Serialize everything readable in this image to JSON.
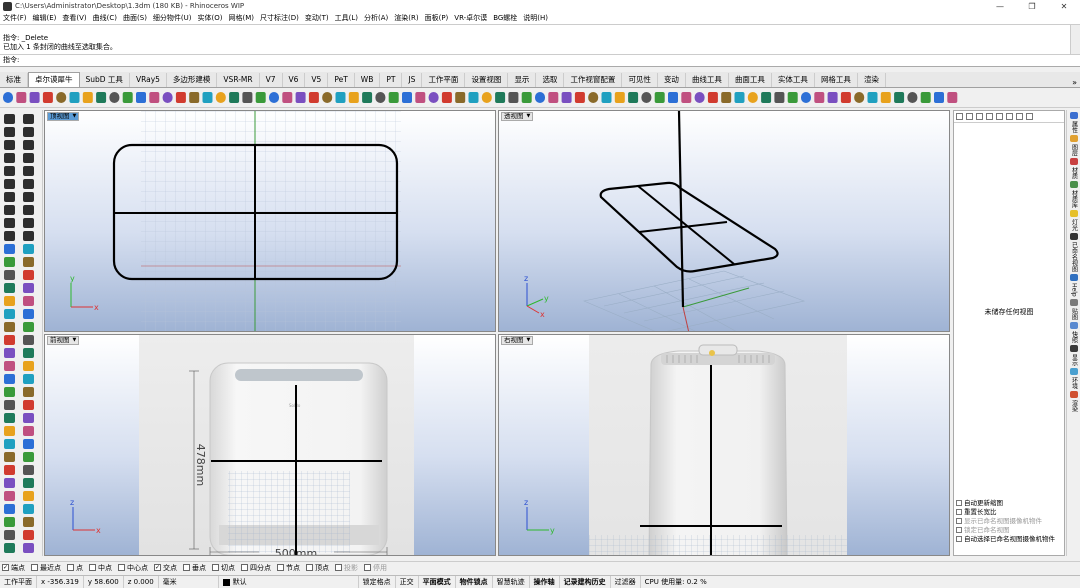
{
  "window": {
    "title": "C:\\Users\\Administrator\\Desktop\\1.3dm (180 KB) - Rhinoceros WIP"
  },
  "menu": [
    "文件(F)",
    "编辑(E)",
    "查看(V)",
    "曲线(C)",
    "曲面(S)",
    "细分物件(U)",
    "实体(O)",
    "网格(M)",
    "尺寸标注(D)",
    "变动(T)",
    "工具(L)",
    "分析(A)",
    "渲染(R)",
    "面板(P)",
    "VR-卓尔谟",
    "BG螺栓",
    "说明(H)"
  ],
  "command": {
    "line1": "指令: _Delete",
    "line2": "已加入 1 条封闭的曲线至选取集合。",
    "prompt": "指令:"
  },
  "tabs": [
    "标准",
    "卓尔谟犀牛",
    "SubD 工具",
    "VRay5",
    "多边形建模",
    "VSR-MR",
    "V7",
    "V6",
    "V5",
    "PeT",
    "WB",
    "PT",
    "JS",
    "工作平面",
    "设置视图",
    "显示",
    "选取",
    "工作视窗配置",
    "可见性",
    "变动",
    "曲线工具",
    "曲面工具",
    "实体工具",
    "网格工具",
    "渲染"
  ],
  "active_tab": "卓尔谟犀牛",
  "viewports": {
    "top": {
      "label": "顶视图"
    },
    "perspective": {
      "label": "透视图"
    },
    "front": {
      "label": "前视图",
      "dim_height": "478mm",
      "dim_width": "500mm",
      "brand": "SolBo"
    },
    "right": {
      "label": "右视图"
    }
  },
  "panel": {
    "empty_text": "未储存任何视图",
    "options": [
      "自动更新缩图",
      "重置长宽比",
      "显示已命名视图摄像机物件",
      "锁定已命名视图",
      "自动选择已命名视图摄像机物件"
    ]
  },
  "side_tabs": [
    "属性",
    "图层",
    "材质",
    "材质库",
    "灯光",
    "已命名视图",
    "Help",
    "贴图",
    "快照",
    "显示",
    "环境",
    "渲染"
  ],
  "osnaps": [
    {
      "label": "端点",
      "checked": true
    },
    {
      "label": "最近点",
      "checked": false
    },
    {
      "label": "点",
      "checked": false
    },
    {
      "label": "中点",
      "checked": false
    },
    {
      "label": "中心点",
      "checked": false
    },
    {
      "label": "交点",
      "checked": true
    },
    {
      "label": "垂点",
      "checked": false
    },
    {
      "label": "切点",
      "checked": false
    },
    {
      "label": "四分点",
      "checked": false
    },
    {
      "label": "节点",
      "checked": false
    },
    {
      "label": "顶点",
      "checked": false
    },
    {
      "label": "投影",
      "checked": false
    },
    {
      "label": "停用",
      "checked": false
    }
  ],
  "status": {
    "cplane": "工作平面",
    "x": "x -356.319",
    "y": "y 58.600",
    "z": "z 0.000",
    "unit": "毫米",
    "layer": "默认",
    "toggles": [
      "锁定格点",
      "正交",
      "平面模式",
      "物件锁点",
      "智慧轨迹",
      "操作轴",
      "记录建构历史",
      "过滤器"
    ],
    "cpu": "CPU 使用量: 0.2 %"
  }
}
